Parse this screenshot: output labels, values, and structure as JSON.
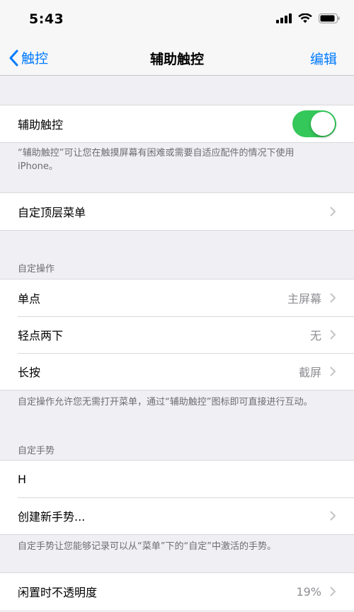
{
  "status": {
    "time": "5:43"
  },
  "nav": {
    "back_label": "触控",
    "title": "辅助触控",
    "edit_label": "编辑"
  },
  "toggle_section": {
    "label": "辅助触控",
    "enabled": true,
    "footnote": "“辅助触控”可让您在触摸屏幕有困难或需要自适应配件的情况下使用 iPhone。"
  },
  "top_menu": {
    "label": "自定顶层菜单"
  },
  "custom_actions": {
    "header": "自定操作",
    "rows": [
      {
        "label": "单点",
        "value": "主屏幕"
      },
      {
        "label": "轻点两下",
        "value": "无"
      },
      {
        "label": "长按",
        "value": "截屏"
      }
    ],
    "footnote": "自定操作允许您无需打开菜单，通过“辅助触控”图标即可直接进行互动。"
  },
  "custom_gestures": {
    "header": "自定手势",
    "rows": [
      {
        "label": "H"
      },
      {
        "label": "创建新手势..."
      }
    ],
    "footnote": "自定手势让您能够记录可以从“菜单”下的“自定”中激活的手势。"
  },
  "idle_opacity": {
    "label": "闲置时不透明度",
    "value": "19%"
  },
  "colors": {
    "accent": "#007aff",
    "toggle_on": "#34c759",
    "background": "#efeff4"
  }
}
